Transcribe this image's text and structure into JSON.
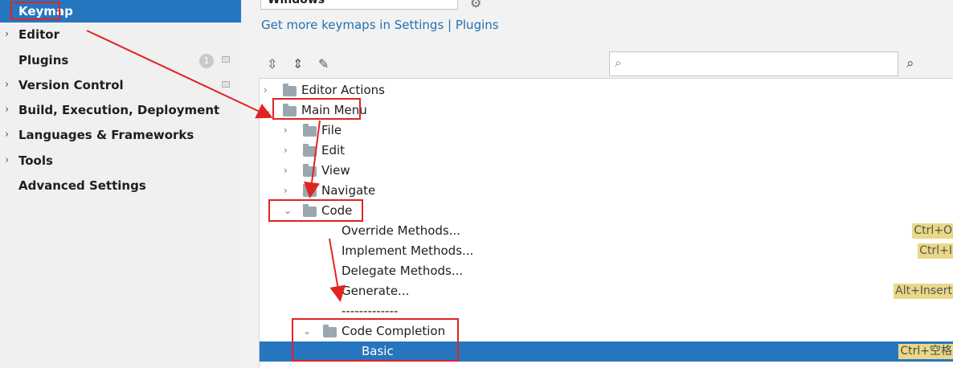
{
  "sidebar": {
    "items": [
      {
        "label": "Keymap",
        "chevron": "",
        "selected": true
      },
      {
        "label": "Editor",
        "chevron": "›"
      },
      {
        "label": "Plugins",
        "chevron": "",
        "badge": "1"
      },
      {
        "label": "Version Control",
        "chevron": "›"
      },
      {
        "label": "Build, Execution, Deployment",
        "chevron": "›"
      },
      {
        "label": "Languages & Frameworks",
        "chevron": "›"
      },
      {
        "label": "Tools",
        "chevron": "›"
      },
      {
        "label": "Advanced Settings",
        "chevron": ""
      }
    ]
  },
  "main": {
    "keymap_value": "Windows",
    "get_more_link": "Get more keymaps in Settings | Plugins",
    "search": {
      "placeholder": ""
    }
  },
  "tree": {
    "rows": [
      {
        "label": "Editor Actions",
        "chevron": "›",
        "shortcut": ""
      },
      {
        "label": "Main Menu",
        "chevron": "⌄",
        "shortcut": ""
      },
      {
        "label": "File",
        "chevron": "›",
        "shortcut": ""
      },
      {
        "label": "Edit",
        "chevron": "›",
        "shortcut": ""
      },
      {
        "label": "View",
        "chevron": "›",
        "shortcut": ""
      },
      {
        "label": "Navigate",
        "chevron": "›",
        "shortcut": ""
      },
      {
        "label": "Code",
        "chevron": "⌄",
        "shortcut": ""
      },
      {
        "label": "Override Methods...",
        "chevron": "",
        "shortcut": "Ctrl+O"
      },
      {
        "label": "Implement Methods...",
        "chevron": "",
        "shortcut": "Ctrl+I"
      },
      {
        "label": "Delegate Methods...",
        "chevron": "",
        "shortcut": ""
      },
      {
        "label": "Generate...",
        "chevron": "",
        "shortcut": "Alt+Insert"
      },
      {
        "label": "-------------",
        "chevron": "",
        "shortcut": ""
      },
      {
        "label": "Code Completion",
        "chevron": "⌄",
        "shortcut": ""
      },
      {
        "label": "Basic",
        "chevron": "",
        "shortcut": "Ctrl+空格",
        "selected": true
      }
    ]
  },
  "colors": {
    "selection": "#2675bf",
    "shortcut_bg": "#e8d887",
    "annotation": "#e02424",
    "link": "#2470b3"
  }
}
